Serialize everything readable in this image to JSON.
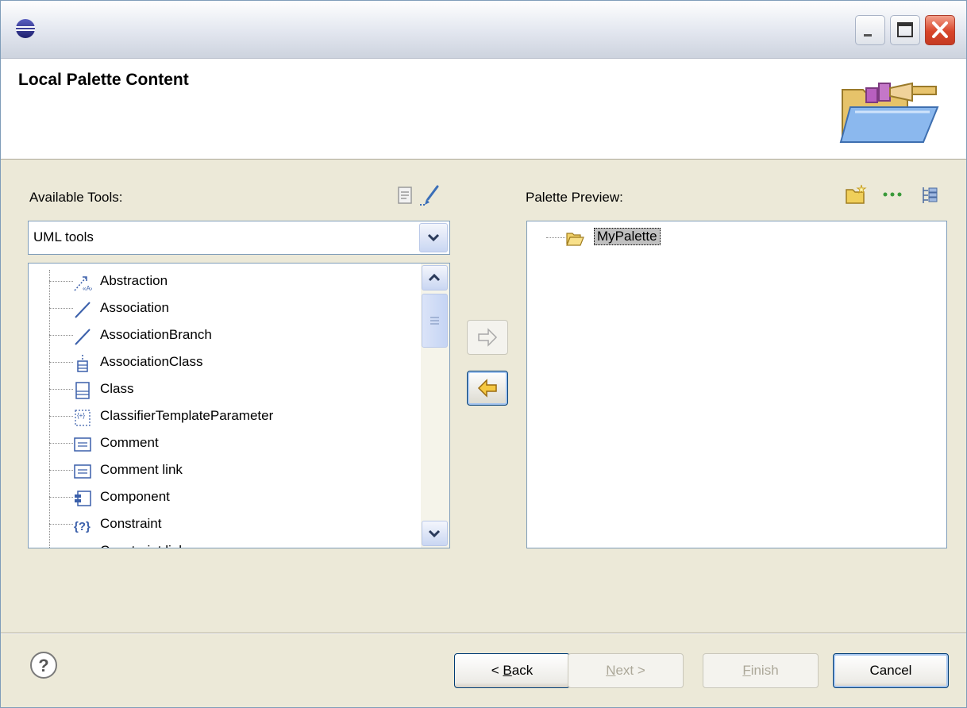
{
  "header": {
    "title": "Local Palette Content"
  },
  "left_panel": {
    "label": "Available Tools:",
    "toolbar_icons": [
      "page-icon",
      "brush-icon"
    ],
    "combo": {
      "value": "UML tools"
    },
    "tools": [
      {
        "label": "Abstraction",
        "icon": "abstraction-icon"
      },
      {
        "label": "Association",
        "icon": "association-icon"
      },
      {
        "label": "AssociationBranch",
        "icon": "association-branch-icon"
      },
      {
        "label": "AssociationClass",
        "icon": "association-class-icon"
      },
      {
        "label": "Class",
        "icon": "class-icon"
      },
      {
        "label": "ClassifierTemplateParameter",
        "icon": "classifier-template-parameter-icon"
      },
      {
        "label": "Comment",
        "icon": "comment-icon"
      },
      {
        "label": "Comment link",
        "icon": "comment-link-icon"
      },
      {
        "label": "Component",
        "icon": "component-icon"
      },
      {
        "label": "Constraint",
        "icon": "constraint-icon"
      },
      {
        "label": "Constraint link",
        "icon": "constraint-link-icon"
      }
    ]
  },
  "right_panel": {
    "label": "Palette Preview:",
    "toolbar_icons": [
      "new-folder-icon",
      "separator-icon",
      "stack-icon"
    ],
    "items": [
      {
        "label": "MyPalette",
        "icon": "folder-open-icon"
      }
    ]
  },
  "buttons": {
    "back": {
      "pre": "< ",
      "mnemonic": "B",
      "rest": "ack"
    },
    "next": {
      "mnemonic": "N",
      "rest": "ext >"
    },
    "finish": {
      "mnemonic": "F",
      "rest": "inish"
    },
    "cancel": "Cancel"
  },
  "colors": {
    "accent": "#003c74",
    "window_bg": "#ece9d8",
    "selection": "#c0c0c0"
  }
}
